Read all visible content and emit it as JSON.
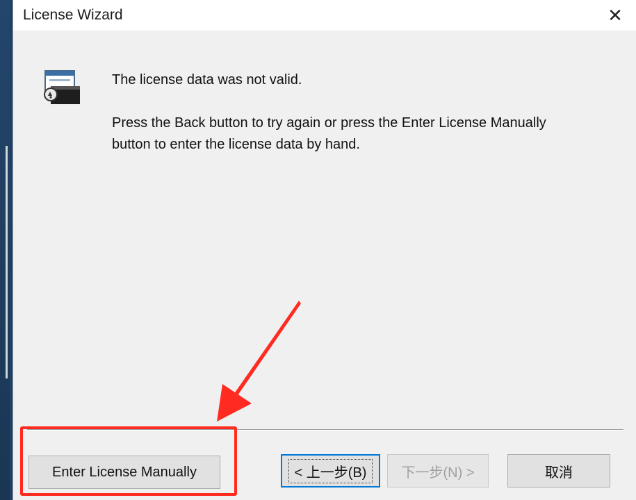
{
  "window": {
    "title": "License Wizard",
    "close_glyph": "✕"
  },
  "message": {
    "title": "The license data was not valid.",
    "body": "Press the Back button to try again or press the Enter License Manually button to enter the license data by hand."
  },
  "buttons": {
    "enter_manually": "Enter License Manually",
    "back": "< 上一步(B)",
    "next": "下一步(N) >",
    "cancel": "取消"
  },
  "annotation": {
    "color": "#ff2a20",
    "target": "enter-license-manually-button"
  },
  "icons": {
    "wizard": "license-wizard-icon",
    "close": "close-icon"
  }
}
